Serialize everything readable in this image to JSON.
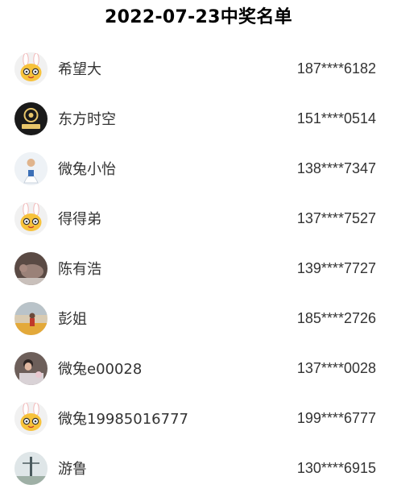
{
  "title": "2022-07-23中奖名单",
  "winners": [
    {
      "name": "希望大",
      "phone": "187****6182",
      "avatar": "rabbit-mascot-avatar"
    },
    {
      "name": "东方时空",
      "phone": "151****0514",
      "avatar": "logo-avatar"
    },
    {
      "name": "微兔小怡",
      "phone": "138****7347",
      "avatar": "person-photo-avatar"
    },
    {
      "name": "得得弟",
      "phone": "137****7527",
      "avatar": "rabbit-mascot-avatar"
    },
    {
      "name": "陈有浩",
      "phone": "139****7727",
      "avatar": "animal-photo-avatar"
    },
    {
      "name": "彭姐",
      "phone": "185****2726",
      "avatar": "scene-photo-avatar"
    },
    {
      "name": "微兔e00028",
      "phone": "137****0028",
      "avatar": "person-photo-avatar"
    },
    {
      "name": "微兔19985016777",
      "phone": "199****6777",
      "avatar": "rabbit-mascot-avatar"
    },
    {
      "name": "游鲁",
      "phone": "130****6915",
      "avatar": "landscape-photo-avatar"
    }
  ]
}
